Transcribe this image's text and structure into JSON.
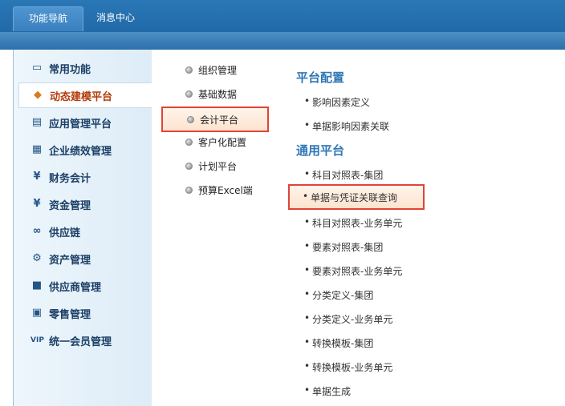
{
  "tabs": [
    {
      "label": "功能导航"
    },
    {
      "label": "消息中心"
    }
  ],
  "sidebar": {
    "items": [
      {
        "label": "常用功能",
        "icon": "monitor-icon"
      },
      {
        "label": "动态建模平台",
        "icon": "cube-icon"
      },
      {
        "label": "应用管理平台",
        "icon": "app-icon"
      },
      {
        "label": "企业绩效管理",
        "icon": "grid-icon"
      },
      {
        "label": "财务会计",
        "icon": "yen-book-icon"
      },
      {
        "label": "资金管理",
        "icon": "yen-icon"
      },
      {
        "label": "供应链",
        "icon": "link-icon"
      },
      {
        "label": "资产管理",
        "icon": "asset-icon"
      },
      {
        "label": "供应商管理",
        "icon": "supplier-icon"
      },
      {
        "label": "零售管理",
        "icon": "register-icon"
      },
      {
        "label": "统一会员管理",
        "icon": "vip-icon"
      }
    ],
    "active_index": 1
  },
  "middle": {
    "items": [
      {
        "label": "组织管理"
      },
      {
        "label": "基础数据"
      },
      {
        "label": "会计平台"
      },
      {
        "label": "客户化配置"
      },
      {
        "label": "计划平台"
      },
      {
        "label": "预算Excel端"
      }
    ],
    "selected_index": 2
  },
  "right": {
    "sections": [
      {
        "title": "平台配置",
        "items": [
          "影响因素定义",
          "单据影响因素关联"
        ]
      },
      {
        "title": "通用平台",
        "items": [
          "科目对照表-集团",
          "单据与凭证关联查询",
          "科目对照表-业务单元",
          "要素对照表-集团",
          "要素对照表-业务单元",
          "分类定义-集团",
          "分类定义-业务单元",
          "转换模板-集团",
          "转换模板-业务单元",
          "单据生成"
        ]
      }
    ],
    "bullet": "•"
  },
  "colors": {
    "header": "#1d62a0",
    "accent_title": "#2f77b5",
    "highlight_border": "#e04438",
    "sidebar_bg": "#ddecf7"
  }
}
